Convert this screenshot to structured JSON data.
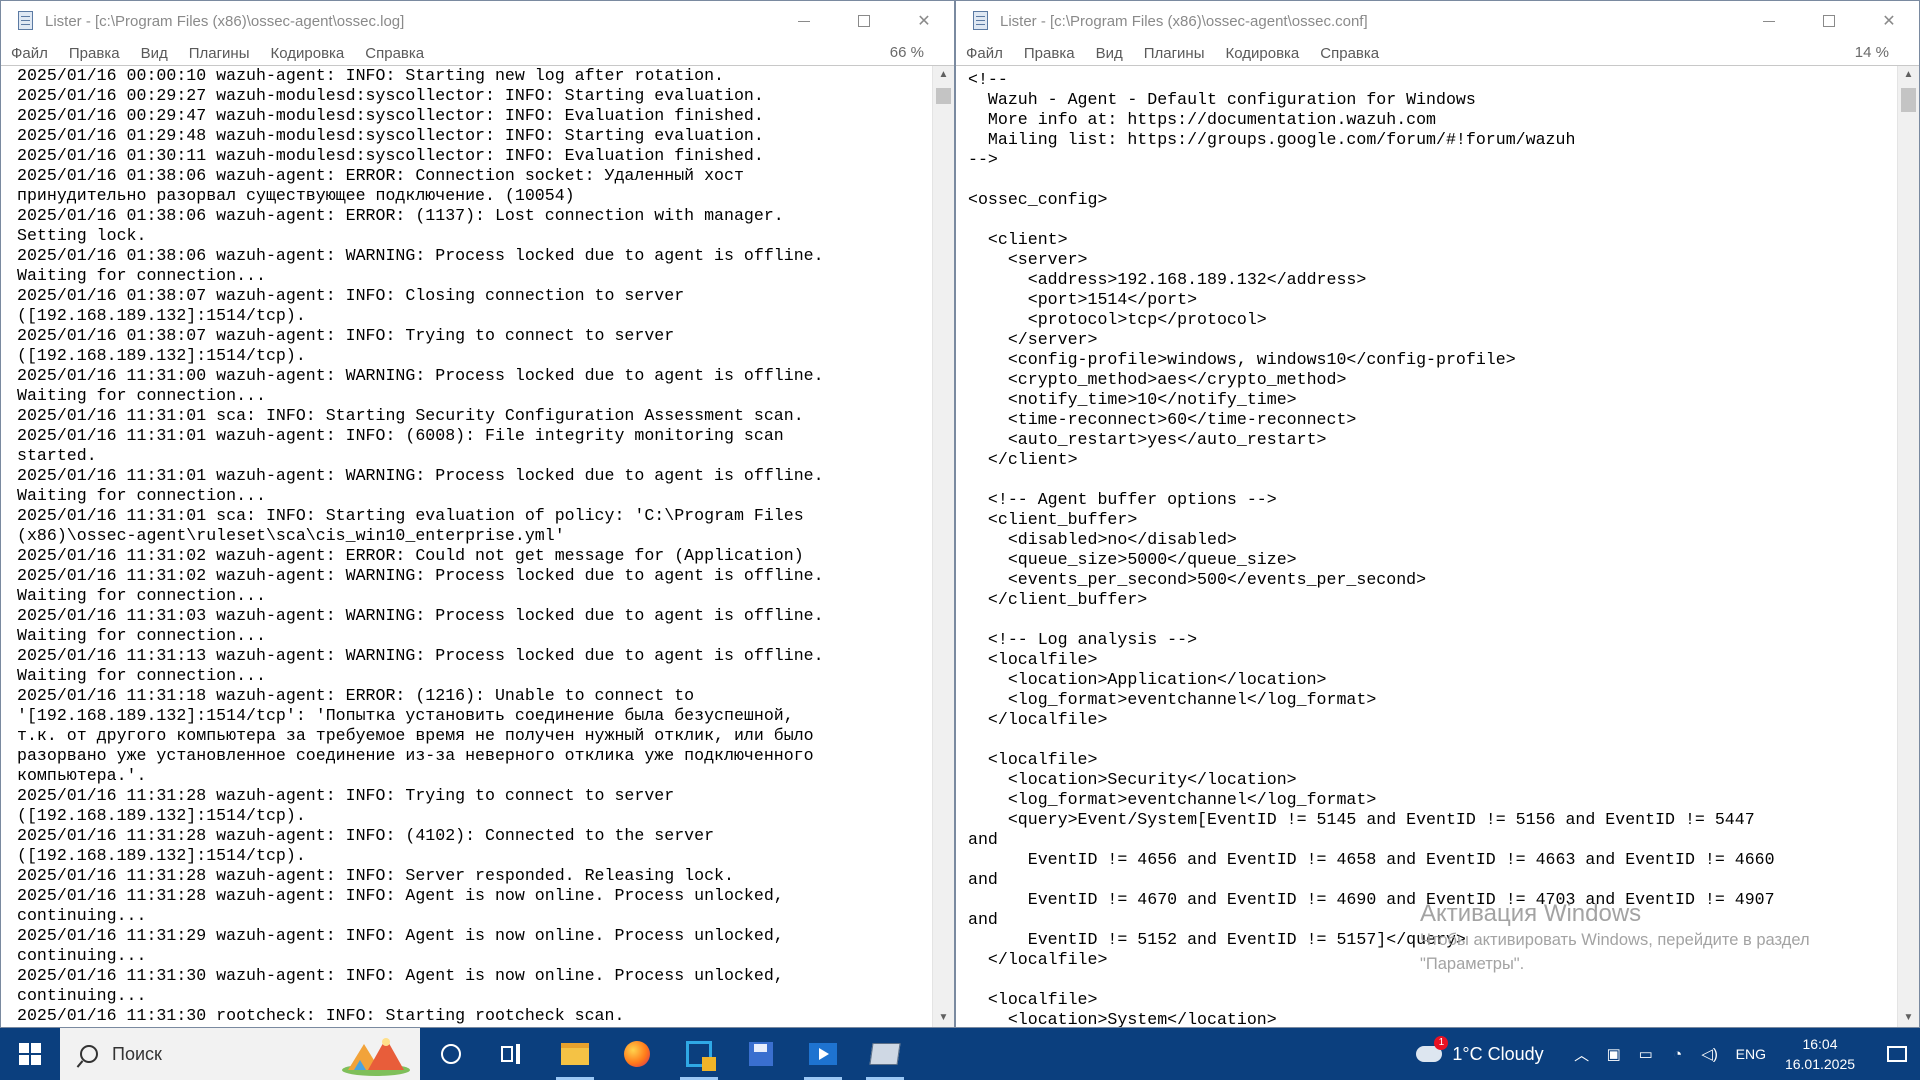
{
  "left_window": {
    "title": "Lister - [c:\\Program Files (x86)\\ossec-agent\\ossec.log]",
    "menu": [
      "Файл",
      "Правка",
      "Вид",
      "Плагины",
      "Кодировка",
      "Справка"
    ],
    "zoom": "66 %",
    "lines": [
      "2025/01/16 00:00:10 wazuh-agent: INFO: Starting new log after rotation.",
      "2025/01/16 00:29:27 wazuh-modulesd:syscollector: INFO: Starting evaluation.",
      "2025/01/16 00:29:47 wazuh-modulesd:syscollector: INFO: Evaluation finished.",
      "2025/01/16 01:29:48 wazuh-modulesd:syscollector: INFO: Starting evaluation.",
      "2025/01/16 01:30:11 wazuh-modulesd:syscollector: INFO: Evaluation finished.",
      "2025/01/16 01:38:06 wazuh-agent: ERROR: Connection socket: Удаленный хост",
      "принудительно разорвал существующее подключение. (10054)",
      "2025/01/16 01:38:06 wazuh-agent: ERROR: (1137): Lost connection with manager.",
      "Setting lock.",
      "2025/01/16 01:38:06 wazuh-agent: WARNING: Process locked due to agent is offline.",
      "Waiting for connection...",
      "2025/01/16 01:38:07 wazuh-agent: INFO: Closing connection to server",
      "([192.168.189.132]:1514/tcp).",
      "2025/01/16 01:38:07 wazuh-agent: INFO: Trying to connect to server",
      "([192.168.189.132]:1514/tcp).",
      "2025/01/16 11:31:00 wazuh-agent: WARNING: Process locked due to agent is offline.",
      "Waiting for connection...",
      "2025/01/16 11:31:01 sca: INFO: Starting Security Configuration Assessment scan.",
      "2025/01/16 11:31:01 wazuh-agent: INFO: (6008): File integrity monitoring scan",
      "started.",
      "2025/01/16 11:31:01 wazuh-agent: WARNING: Process locked due to agent is offline.",
      "Waiting for connection...",
      "2025/01/16 11:31:01 sca: INFO: Starting evaluation of policy: 'C:\\Program Files",
      "(x86)\\ossec-agent\\ruleset\\sca\\cis_win10_enterprise.yml'",
      "2025/01/16 11:31:02 wazuh-agent: ERROR: Could not get message for (Application)",
      "2025/01/16 11:31:02 wazuh-agent: WARNING: Process locked due to agent is offline.",
      "Waiting for connection...",
      "2025/01/16 11:31:03 wazuh-agent: WARNING: Process locked due to agent is offline.",
      "Waiting for connection...",
      "2025/01/16 11:31:13 wazuh-agent: WARNING: Process locked due to agent is offline.",
      "Waiting for connection...",
      "2025/01/16 11:31:18 wazuh-agent: ERROR: (1216): Unable to connect to",
      "'[192.168.189.132]:1514/tcp': 'Попытка установить соединение была безуспешной,",
      "т.к. от другого компьютера за требуемое время не получен нужный отклик, или было",
      "разорвано уже установленное соединение из-за неверного отклика уже подключенного",
      "компьютера.'.",
      "2025/01/16 11:31:28 wazuh-agent: INFO: Trying to connect to server",
      "([192.168.189.132]:1514/tcp).",
      "2025/01/16 11:31:28 wazuh-agent: INFO: (4102): Connected to the server",
      "([192.168.189.132]:1514/tcp).",
      "2025/01/16 11:31:28 wazuh-agent: INFO: Server responded. Releasing lock.",
      "2025/01/16 11:31:28 wazuh-agent: INFO: Agent is now online. Process unlocked,",
      "continuing...",
      "2025/01/16 11:31:29 wazuh-agent: INFO: Agent is now online. Process unlocked,",
      "continuing...",
      "2025/01/16 11:31:30 wazuh-agent: INFO: Agent is now online. Process unlocked,",
      "continuing...",
      "2025/01/16 11:31:30 rootcheck: INFO: Starting rootcheck scan."
    ]
  },
  "right_window": {
    "title": "Lister - [c:\\Program Files (x86)\\ossec-agent\\ossec.conf]",
    "menu": [
      "Файл",
      "Правка",
      "Вид",
      "Плагины",
      "Кодировка",
      "Справка"
    ],
    "zoom": "14 %",
    "lines": [
      "<!--",
      "  Wazuh - Agent - Default configuration for Windows",
      "  More info at: https://documentation.wazuh.com",
      "  Mailing list: https://groups.google.com/forum/#!forum/wazuh",
      "-->",
      "",
      "<ossec_config>",
      "",
      "  <client>",
      "    <server>",
      "      <address>192.168.189.132</address>",
      "      <port>1514</port>",
      "      <protocol>tcp</protocol>",
      "    </server>",
      "    <config-profile>windows, windows10</config-profile>",
      "    <crypto_method>aes</crypto_method>",
      "    <notify_time>10</notify_time>",
      "    <time-reconnect>60</time-reconnect>",
      "    <auto_restart>yes</auto_restart>",
      "  </client>",
      "",
      "  <!-- Agent buffer options -->",
      "  <client_buffer>",
      "    <disabled>no</disabled>",
      "    <queue_size>5000</queue_size>",
      "    <events_per_second>500</events_per_second>",
      "  </client_buffer>",
      "",
      "  <!-- Log analysis -->",
      "  <localfile>",
      "    <location>Application</location>",
      "    <log_format>eventchannel</log_format>",
      "  </localfile>",
      "",
      "  <localfile>",
      "    <location>Security</location>",
      "    <log_format>eventchannel</log_format>",
      "    <query>Event/System[EventID != 5145 and EventID != 5156 and EventID != 5447",
      "and",
      "      EventID != 4656 and EventID != 4658 and EventID != 4663 and EventID != 4660",
      "and",
      "      EventID != 4670 and EventID != 4690 and EventID != 4703 and EventID != 4907",
      "and",
      "      EventID != 5152 and EventID != 5157]</query>",
      "  </localfile>",
      "",
      "  <localfile>",
      "    <location>System</location>"
    ]
  },
  "activation": {
    "heading": "Активация Windows",
    "body": "Чтобы активировать Windows, перейдите в раздел \"Параметры\"."
  },
  "taskbar": {
    "search_placeholder": "Поиск",
    "apps": [
      "cortana-icon",
      "task-view-icon",
      "file-explorer-icon",
      "firefox-icon",
      "total-commander-icon",
      "save-icon",
      "media-icon",
      "lister-icon"
    ],
    "weather_badge": "1",
    "weather": "1°C  Cloudy",
    "language": "ENG",
    "time": "16:04",
    "date": "16.01.2025"
  }
}
